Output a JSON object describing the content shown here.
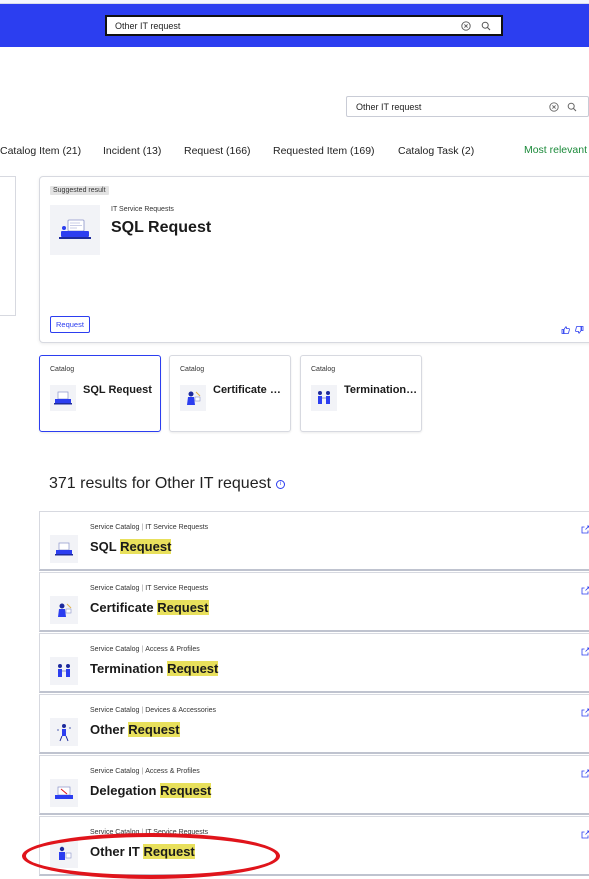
{
  "header": {
    "search_value": "Other IT request"
  },
  "page_search": {
    "value": "Other IT request"
  },
  "tabs": [
    {
      "label": "Catalog Item (21)"
    },
    {
      "label": "Incident (13)"
    },
    {
      "label": "Request (166)"
    },
    {
      "label": "Requested Item (169)"
    },
    {
      "label": "Catalog Task (2)"
    }
  ],
  "sort_label": "Most relevant",
  "suggested": {
    "badge": "Suggested result",
    "category": "IT Service Requests",
    "title": "SQL Request",
    "button": "Request"
  },
  "cards": [
    {
      "category": "Catalog",
      "title": "SQL Request"
    },
    {
      "category": "Catalog",
      "title": "Certificate Request"
    },
    {
      "category": "Catalog",
      "title": "Termination Request"
    }
  ],
  "results_count_text": "371 results for Other IT request",
  "results": [
    {
      "source": "Service Catalog",
      "category": "IT Service Requests",
      "title_prefix": "SQL",
      "title_highlight": "Request"
    },
    {
      "source": "Service Catalog",
      "category": "IT Service Requests",
      "title_prefix": "Certificate",
      "title_highlight": "Request"
    },
    {
      "source": "Service Catalog",
      "category": "Access & Profiles",
      "title_prefix": "Termination",
      "title_highlight": "Request"
    },
    {
      "source": "Service Catalog",
      "category": "Devices & Accessories",
      "title_prefix": "Other",
      "title_highlight": "Request"
    },
    {
      "source": "Service Catalog",
      "category": "Access & Profiles",
      "title_prefix": "Delegation",
      "title_highlight": "Request"
    },
    {
      "source": "Service Catalog",
      "category": "IT Service Requests",
      "title_prefix": "Other IT",
      "title_highlight": "Request"
    }
  ],
  "colors": {
    "brand": "#2c3ef0",
    "highlight": "#e8e05c",
    "sort": "#1b8a3a",
    "annotation": "#e0141b"
  }
}
